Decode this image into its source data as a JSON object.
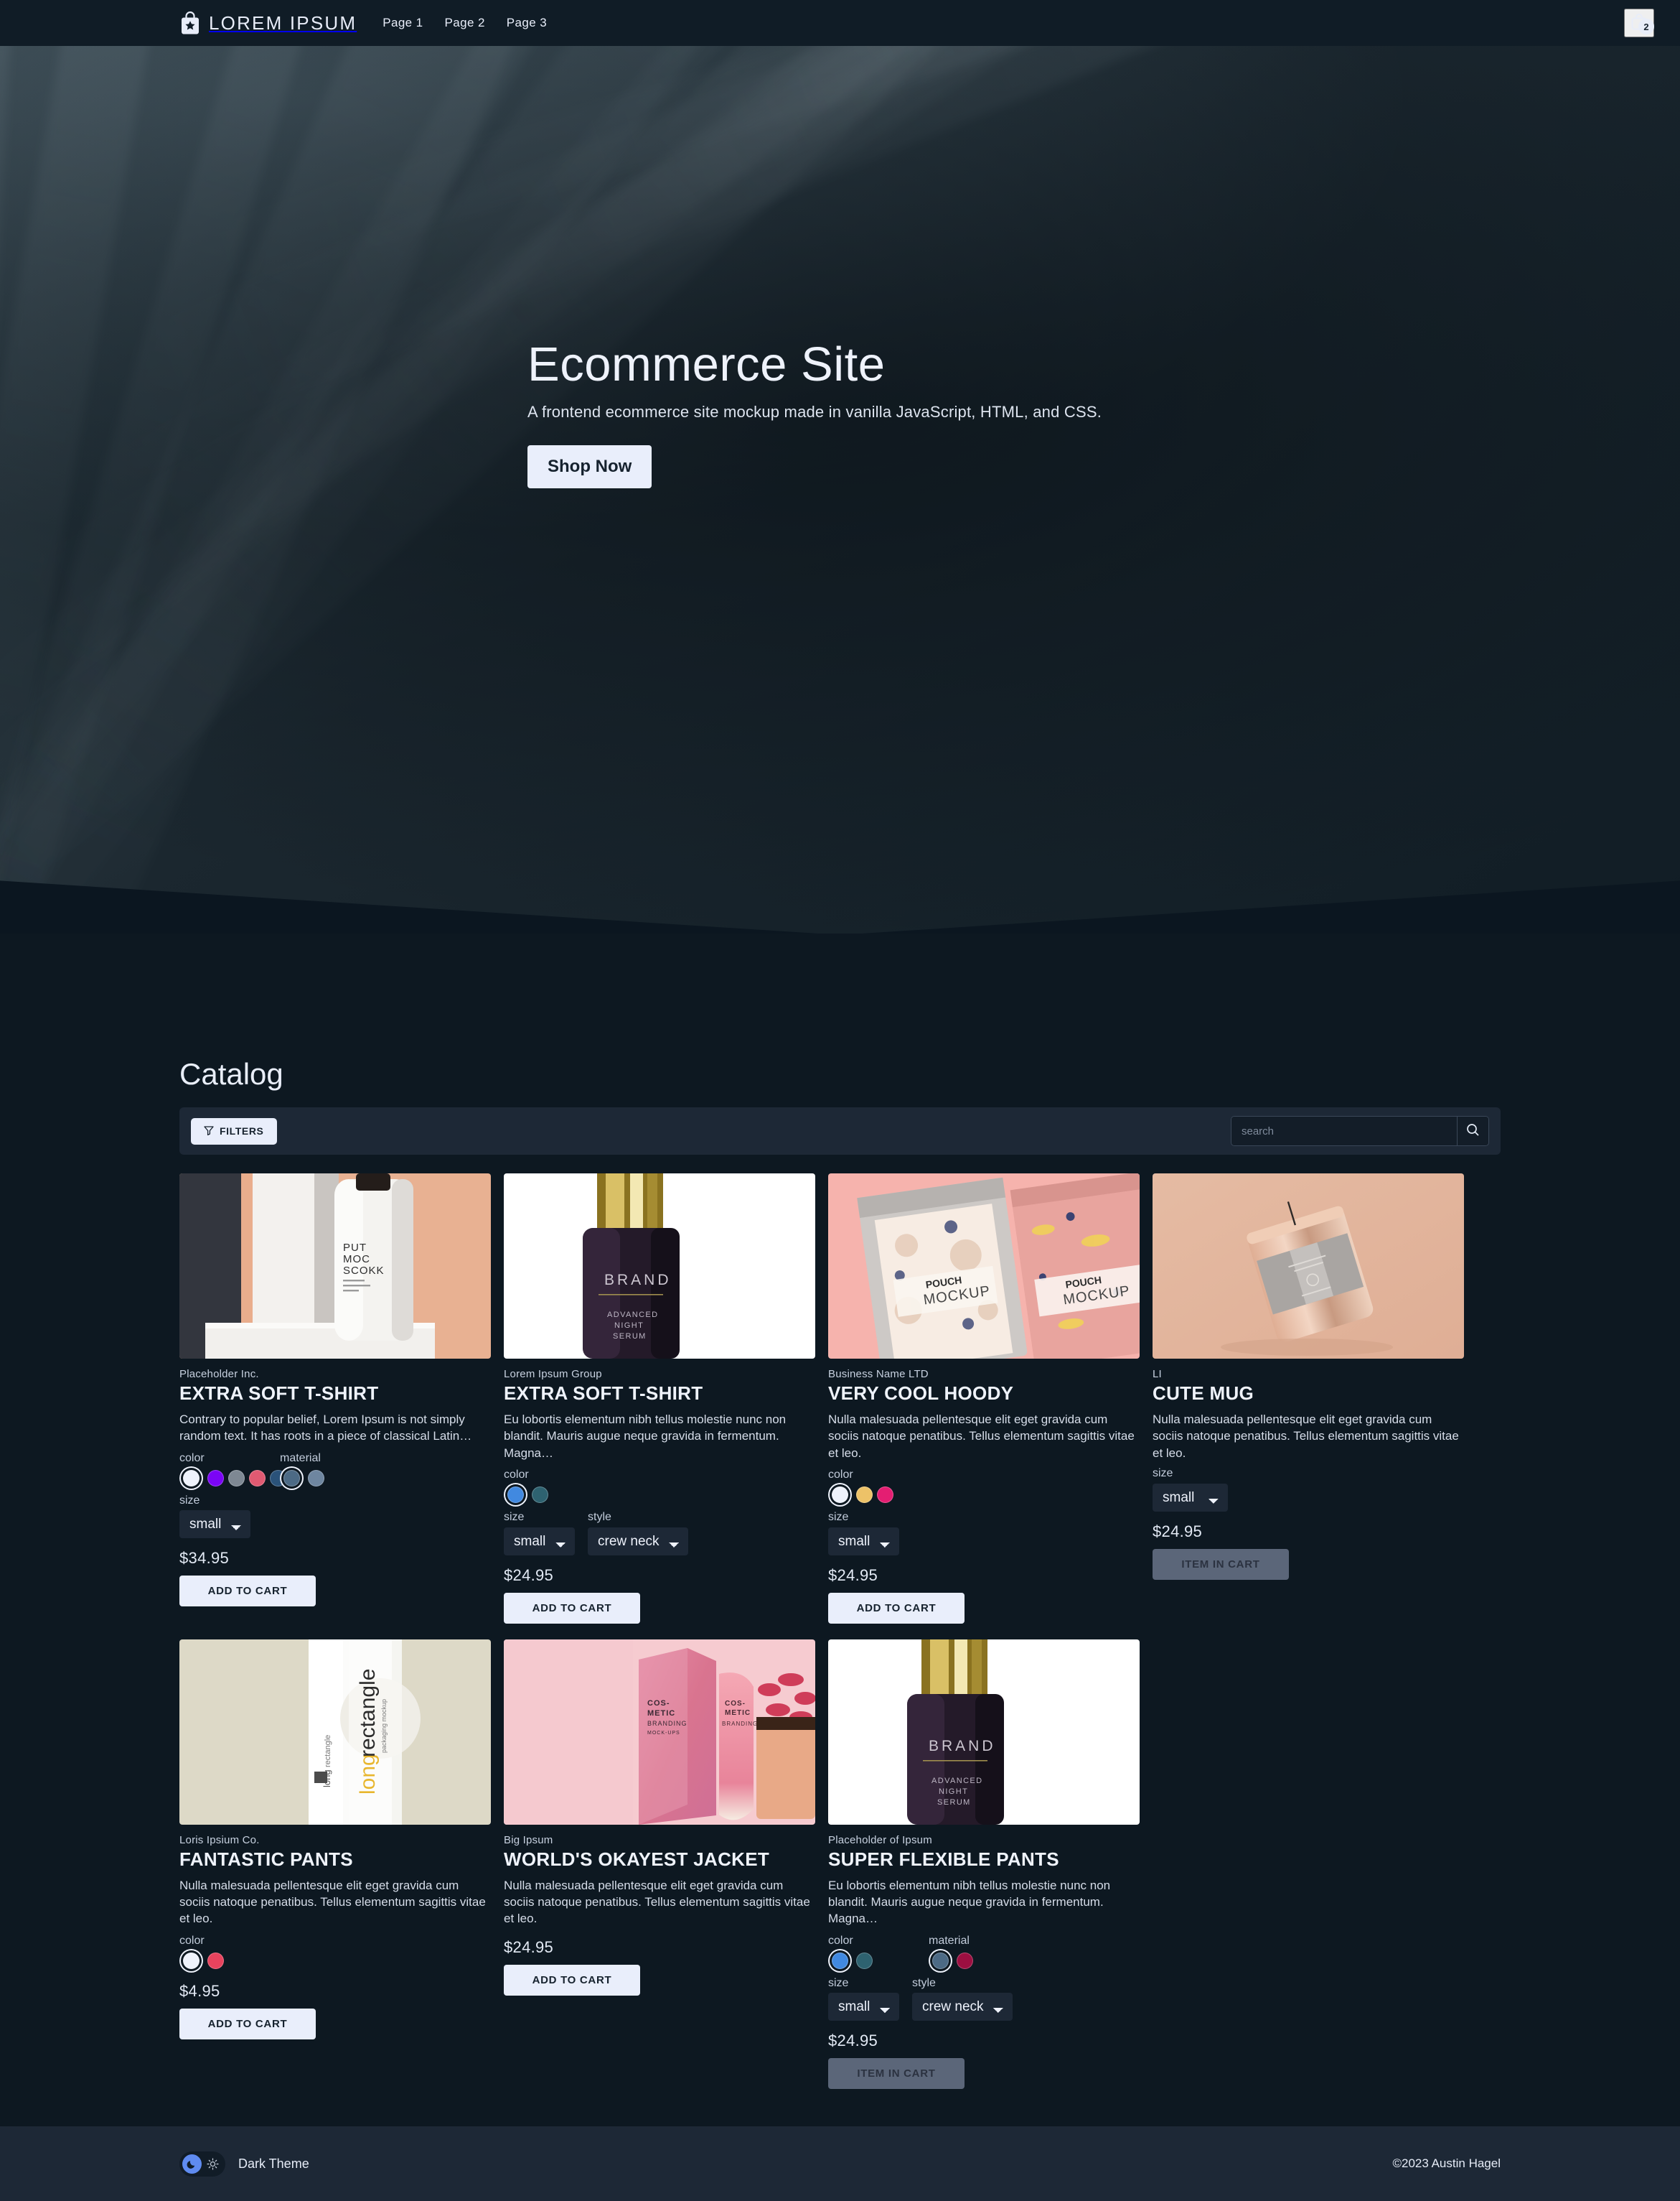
{
  "nav": {
    "logo_icon": "shopping-bag-star-icon",
    "brand": "LOREM IPSUM",
    "links": [
      {
        "label": "Page 1"
      },
      {
        "label": "Page 2"
      },
      {
        "label": "Page 3"
      }
    ],
    "cart_icon": "shopping-bag-icon",
    "cart_count": "2"
  },
  "hero": {
    "title": "Ecommerce Site",
    "subtitle": "A frontend ecommerce site mockup made in vanilla JavaScript, HTML, and CSS.",
    "cta": "Shop Now"
  },
  "catalog": {
    "title": "Catalog",
    "filters_label": "FILTERS",
    "filters_icon": "funnel-icon",
    "search_placeholder": "search",
    "search_value": "",
    "search_icon": "search-icon"
  },
  "labels": {
    "color": "color",
    "material": "material",
    "size": "size",
    "style": "style",
    "add_to_cart": "ADD TO CART",
    "item_in_cart": "ITEM IN CART"
  },
  "colors": {
    "page_bg": "#0d1821",
    "nav_bg": "#101c26",
    "panel_bg": "#1d2836",
    "accent_light": "#e9eefb",
    "text": "#eef2fb",
    "muted": "#c2ccdb",
    "in_cart_bg": "#5b6679",
    "toggle_knob": "#5f8bf0"
  },
  "products": [
    {
      "vendor": "Placeholder Inc.",
      "name": "EXTRA SOFT T-SHIRT",
      "desc": "Contrary to popular belief, Lorem Ipsum is not simply random text. It has roots in a piece of classical Latin…",
      "colors": [
        "#eef2fb",
        "#7b05f5",
        "#7e8893",
        "#e05a72",
        "#2a5279"
      ],
      "colors_selected": 0,
      "materials": [
        "#4c6a85",
        "#6e86a0"
      ],
      "materials_selected": 0,
      "size": "small",
      "style": null,
      "price": "$34.95",
      "button": "ADD TO CART",
      "in_cart": false,
      "image": "white-bottle-put-moc-scokk"
    },
    {
      "vendor": "Lorem Ipsum Group",
      "name": "EXTRA SOFT T-SHIRT",
      "desc": "Eu lobortis elementum nibh tellus molestie nunc non blandit. Mauris augue neque gravida in fermentum. Magna…",
      "colors": [
        "#4189e0",
        "#2e6270"
      ],
      "colors_selected": 0,
      "materials": [],
      "materials_selected": null,
      "size": "small",
      "style": "crew neck",
      "price": "$24.95",
      "button": "ADD TO CART",
      "in_cart": false,
      "image": "dark-serum-bottle-brand"
    },
    {
      "vendor": "Business Name LTD",
      "name": "VERY COOL HOODY",
      "desc": "Nulla malesuada pellentesque elit eget gravida cum sociis natoque penatibus. Tellus elementum sagittis vitae et leo.",
      "colors": [
        "#eef2fb",
        "#edc268",
        "#e41e72"
      ],
      "colors_selected": 0,
      "materials": [],
      "materials_selected": null,
      "size": "small",
      "style": null,
      "price": "$24.95",
      "button": "ADD TO CART",
      "in_cart": false,
      "image": "pink-pouch-mockup"
    },
    {
      "vendor": "LI",
      "name": "CUTE MUG",
      "desc": "Nulla malesuada pellentesque elit eget gravida cum sociis natoque penatibus. Tellus elementum sagittis vitae et leo.",
      "colors": [],
      "colors_selected": null,
      "materials": [],
      "materials_selected": null,
      "size": "small",
      "style": null,
      "price": "$24.95",
      "button": "ITEM IN CART",
      "in_cart": true,
      "image": "rose-gold-candle"
    },
    {
      "vendor": "Loris Ipsium Co.",
      "name": "FANTASTIC PANTS",
      "desc": "Nulla malesuada pellentesque elit eget gravida cum sociis natoque penatibus. Tellus elementum sagittis vitae et leo.",
      "colors": [
        "#eef2fb",
        "#e8435e"
      ],
      "colors_selected": 0,
      "materials": [],
      "materials_selected": null,
      "size": null,
      "style": null,
      "price": "$4.95",
      "button": "ADD TO CART",
      "in_cart": false,
      "image": "long-rectangle-box"
    },
    {
      "vendor": "Big Ipsum",
      "name": "WORLD'S OKAYEST JACKET",
      "desc": "Nulla malesuada pellentesque elit eget gravida cum sociis natoque penatibus. Tellus elementum sagittis vitae et leo.",
      "colors": [],
      "colors_selected": null,
      "materials": [],
      "materials_selected": null,
      "size": null,
      "style": null,
      "price": "$24.95",
      "button": "ADD TO CART",
      "in_cart": false,
      "image": "pink-cosmetic-branding"
    },
    {
      "vendor": "Placeholder of Ipsum",
      "name": "SUPER FLEXIBLE PANTS",
      "desc": "Eu lobortis elementum nibh tellus molestie nunc non blandit. Mauris augue neque gravida in fermentum. Magna…",
      "colors": [
        "#4189e0",
        "#2e6270"
      ],
      "colors_selected": 0,
      "materials": [
        "#4c6a85",
        "#9c0f41"
      ],
      "materials_selected": 0,
      "size": "small",
      "style": "crew neck",
      "price": "$24.95",
      "button": "ITEM IN CART",
      "in_cart": true,
      "image": "dark-serum-bottle-brand"
    }
  ],
  "footer": {
    "theme_label": "Dark Theme",
    "moon_icon": "moon-icon",
    "sun_icon": "sun-icon",
    "copyright": "©2023 Austin Hagel"
  }
}
